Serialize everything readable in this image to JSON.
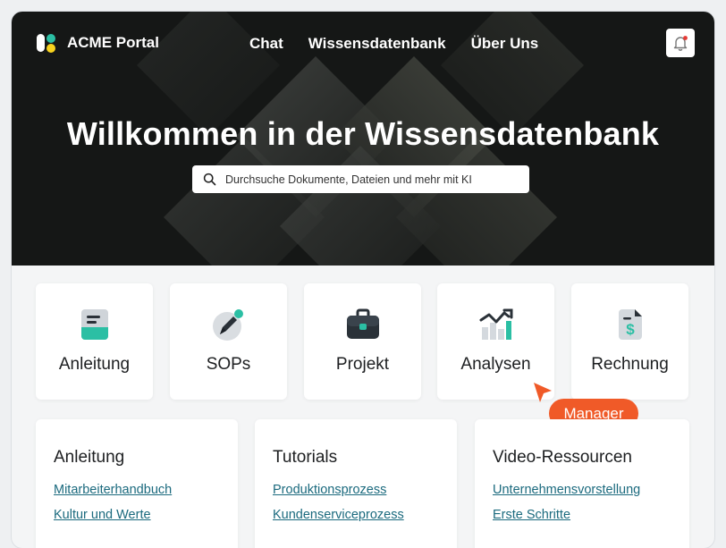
{
  "header": {
    "brand_name": "ACME Portal",
    "nav": [
      {
        "label": "Chat"
      },
      {
        "label": "Wissensdatenbank"
      },
      {
        "label": "Über Uns"
      }
    ]
  },
  "hero": {
    "title": "Willkommen in der Wissensdatenbank",
    "search_placeholder": "Durchsuche Dokumente, Dateien und mehr mit KI"
  },
  "categories": [
    {
      "label": "Anleitung",
      "icon": "document-icon"
    },
    {
      "label": "SOPs",
      "icon": "pen-icon"
    },
    {
      "label": "Projekt",
      "icon": "briefcase-icon"
    },
    {
      "label": "Analysen",
      "icon": "chart-icon"
    },
    {
      "label": "Rechnung",
      "icon": "invoice-icon"
    }
  ],
  "cursor_badge": {
    "label": "Manager"
  },
  "resources": [
    {
      "title": "Anleitung",
      "links": [
        "Mitarbeiterhandbuch",
        "Kultur und Werte"
      ]
    },
    {
      "title": "Tutorials",
      "links": [
        "Produktionsprozess",
        "Kundenserviceprozess"
      ]
    },
    {
      "title": "Video-Ressourcen",
      "links": [
        "Unternehmensvorstellung",
        "Erste Schritte"
      ]
    }
  ],
  "colors": {
    "accent": "#f05a28",
    "teal": "#2bbfa4",
    "link": "#1b6a7e",
    "hero_bg": "#151716",
    "logo_yellow": "#f7d21e"
  }
}
